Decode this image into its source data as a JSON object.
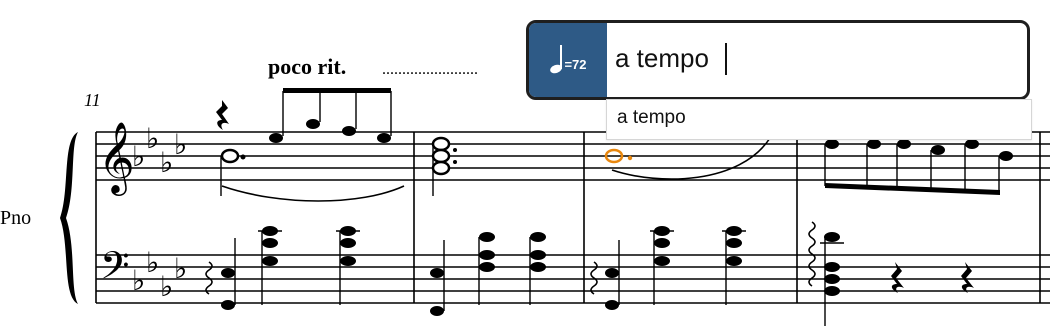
{
  "score": {
    "measure_number": "11",
    "instrument_label": "Pno",
    "tempo_text": "poco rit.",
    "dotted_line": "........................"
  },
  "popover": {
    "metronome_mark": "=72",
    "input_value": "a tempo",
    "suggestions": [
      "a tempo"
    ]
  },
  "colors": {
    "chip": "#2e5a86",
    "selected_note": "#e8870e",
    "ink": "#000000"
  }
}
